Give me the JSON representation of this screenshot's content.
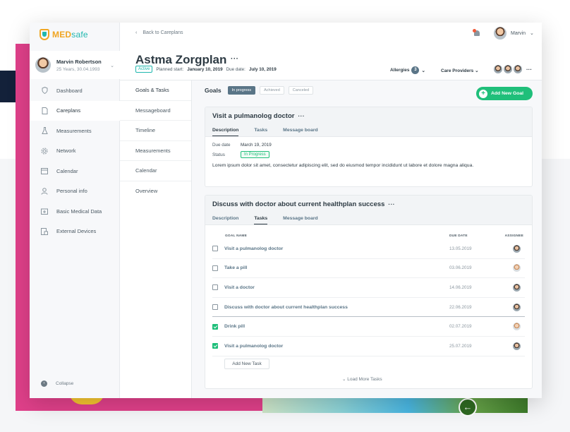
{
  "app": {
    "logo_med": "MED",
    "logo_safe": "safe"
  },
  "profile": {
    "name": "Marvin Robertson",
    "meta": "25 Years, 30.04.1993"
  },
  "sidebar": {
    "items": [
      {
        "label": "Dashboard",
        "icon": "shield-icon"
      },
      {
        "label": "Careplans",
        "icon": "document-icon"
      },
      {
        "label": "Measurements",
        "icon": "flask-icon"
      },
      {
        "label": "Network",
        "icon": "network-icon"
      },
      {
        "label": "Calendar",
        "icon": "calendar-icon"
      },
      {
        "label": "Personal info",
        "icon": "person-icon"
      },
      {
        "label": "Basic Medical Data",
        "icon": "medical-kit-icon"
      },
      {
        "label": "External Devices",
        "icon": "device-icon"
      }
    ],
    "collapse_label": "Collapse"
  },
  "subnav": {
    "items": [
      "Goals & Tasks",
      "Messageboard",
      "Timeline",
      "Measurements",
      "Calendar",
      "Overview"
    ]
  },
  "topbar": {
    "back_label": "Back to Careplans",
    "user_name": "Marvin"
  },
  "header": {
    "title": "Astma Zorgplan",
    "status": "Active",
    "planned_start_label": "Planned start:",
    "planned_start": "January 10, 2019",
    "due_date_label": "Due date:",
    "due_date": "July 10, 2019",
    "allergies_label": "Allergies",
    "allergies_count": "3",
    "care_providers_label": "Care Providers"
  },
  "goals": {
    "label": "Goals",
    "filters": [
      "In progress",
      "Achieved",
      "Canceled"
    ],
    "add_goal_label": "Add New Goal"
  },
  "goal1": {
    "title": "Visit a pulmanolog doctor",
    "tabs": [
      "Description",
      "Tasks",
      "Message board"
    ],
    "due_date_label": "Due date",
    "due_date": "March 19, 2019",
    "status_label": "Status",
    "status": "In Progress",
    "description": "Lorem ipsum dolor sit amet, consectetur adipiscing elit, sed do eiusmod tempor incididunt ut labore et dolore magna aliqua."
  },
  "goal2": {
    "title": "Discuss with doctor about current healthplan success",
    "tabs": [
      "Description",
      "Tasks",
      "Message board"
    ],
    "columns": {
      "name": "GOAL NAME",
      "due": "DUE DATE",
      "assignee": "ASSIGNEE"
    },
    "tasks": [
      {
        "name": "Visit a pulmanolog doctor",
        "due": "13.05.2019",
        "done": false
      },
      {
        "name": "Take a pill",
        "due": "03.06.2019",
        "done": false
      },
      {
        "name": "Visit a doctor",
        "due": "14.06.2019",
        "done": false
      },
      {
        "name": "Discuss with doctor about current healthplan success",
        "due": "22.06.2019",
        "done": false
      },
      {
        "name": "Drink pill",
        "due": "02.07.2019",
        "done": true
      },
      {
        "name": "Visit a pulmanolog doctor",
        "due": "25.07.2019",
        "done": true
      }
    ],
    "add_task_label": "Add New Task",
    "load_more_label": "Load More Tasks"
  },
  "colors": {
    "accent_green": "#1fbf7a",
    "teal": "#1fb7ae",
    "brand_orange": "#f0a623",
    "badge_slate": "#5a7587"
  }
}
